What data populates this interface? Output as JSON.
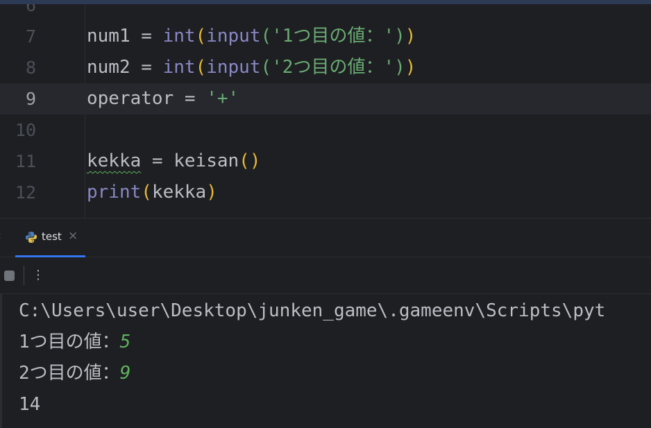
{
  "editor": {
    "lines": [
      {
        "number": "6",
        "tokens": []
      },
      {
        "number": "7",
        "tokens": [
          {
            "text": "num1 = ",
            "kind": "plain"
          },
          {
            "text": "int",
            "kind": "builtin"
          },
          {
            "text": "(",
            "kind": "paren"
          },
          {
            "text": "input",
            "kind": "builtin"
          },
          {
            "text": "(",
            "kind": "paren2"
          },
          {
            "text": "'1つ目の値：'",
            "kind": "string"
          },
          {
            "text": ")",
            "kind": "paren2"
          },
          {
            "text": ")",
            "kind": "paren"
          }
        ]
      },
      {
        "number": "8",
        "tokens": [
          {
            "text": "num2 = ",
            "kind": "plain"
          },
          {
            "text": "int",
            "kind": "builtin"
          },
          {
            "text": "(",
            "kind": "paren"
          },
          {
            "text": "input",
            "kind": "builtin"
          },
          {
            "text": "(",
            "kind": "paren2"
          },
          {
            "text": "'2つ目の値：'",
            "kind": "string"
          },
          {
            "text": ")",
            "kind": "paren2"
          },
          {
            "text": ")",
            "kind": "paren"
          }
        ]
      },
      {
        "number": "9",
        "current": true,
        "tokens": [
          {
            "text": "operator = ",
            "kind": "plain"
          },
          {
            "text": "'+'",
            "kind": "string"
          }
        ]
      },
      {
        "number": "10",
        "tokens": []
      },
      {
        "number": "11",
        "tokens": [
          {
            "text": "kekka",
            "kind": "warning"
          },
          {
            "text": " = keisan",
            "kind": "plain"
          },
          {
            "text": "()",
            "kind": "paren"
          }
        ]
      },
      {
        "number": "12",
        "tokens": [
          {
            "text": "print",
            "kind": "builtin"
          },
          {
            "text": "(",
            "kind": "paren"
          },
          {
            "text": "kekka",
            "kind": "plain"
          },
          {
            "text": ")",
            "kind": "paren"
          }
        ]
      }
    ]
  },
  "run_panel": {
    "tab_label": "test",
    "tab_icon": "python-icon",
    "close_glyph": "×",
    "more_glyph": "⋮",
    "console": {
      "path_line": "C:\\Users\\user\\Desktop\\junken_game\\.gameenv\\Scripts\\pyt",
      "prompt1": "1つ目の値：",
      "input1": "5",
      "prompt2": "2つ目の値：",
      "input2": "9",
      "result": "14"
    }
  },
  "colors": {
    "background": "#1e1f22",
    "builtin": "#8888c6",
    "paren": "#e8ba36",
    "string": "#6aab73",
    "input_echo": "#5fb35f",
    "accent": "#3574f0"
  }
}
